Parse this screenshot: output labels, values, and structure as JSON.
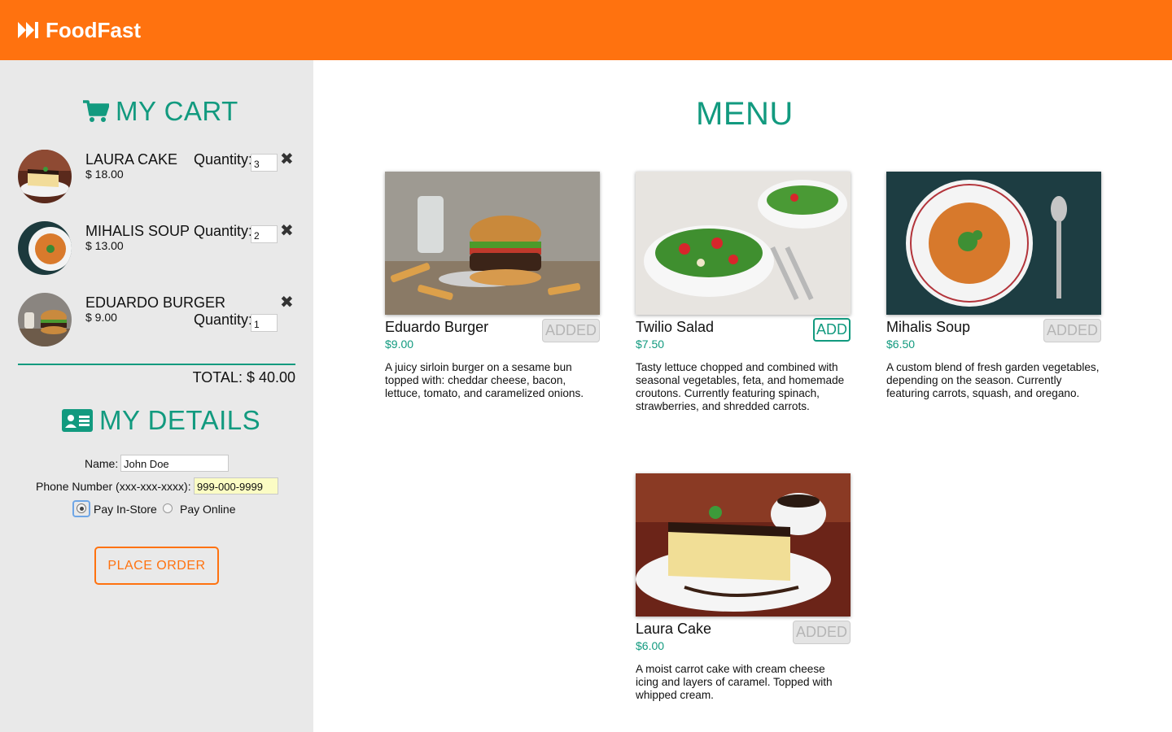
{
  "app": {
    "name": "FoodFast"
  },
  "colors": {
    "brand": "#ff720f",
    "accent": "#129a7f",
    "sidebar_bg": "#e9e9e9"
  },
  "cart": {
    "title": "MY CART",
    "quantity_label": "Quantity:",
    "items": [
      {
        "name": "LAURA CAKE",
        "price": "$ 18.00",
        "quantity": "3"
      },
      {
        "name": "MIHALIS SOUP",
        "price": "$ 13.00",
        "quantity": "2"
      },
      {
        "name": "EDUARDO BURGER",
        "price": "$ 9.00",
        "quantity": "1"
      }
    ],
    "total": "TOTAL: $ 40.00"
  },
  "details": {
    "title": "MY DETAILS",
    "name_label": "Name:",
    "name_value": "John Doe",
    "phone_label": "Phone Number (xxx-xxx-xxxx):",
    "phone_value": "999-000-9999",
    "pay_instore_label": "Pay In-Store",
    "pay_online_label": "Pay Online",
    "selected_payment": "Pay In-Store",
    "place_order_label": "PLACE ORDER"
  },
  "menu": {
    "title": "MENU",
    "items": [
      {
        "name": "Eduardo Burger",
        "price": "$9.00",
        "button": "ADDED",
        "description": "A juicy sirloin burger on a sesame bun topped with: cheddar cheese, bacon, lettuce, tomato, and caramelized onions."
      },
      {
        "name": "Twilio Salad",
        "price": "$7.50",
        "button": "ADD",
        "description": "Tasty lettuce chopped and combined with seasonal vegetables, feta, and homemade croutons. Currently featuring spinach, strawberries, and shredded carrots."
      },
      {
        "name": "Mihalis Soup",
        "price": "$6.50",
        "button": "ADDED",
        "description": "A custom blend of fresh garden vegetables, depending on the season. Currently featuring carrots, squash, and oregano."
      },
      {
        "name": "Laura Cake",
        "price": "$6.00",
        "button": "ADDED",
        "description": "A moist carrot cake with cream cheese icing and layers of caramel. Topped with whipped cream."
      }
    ]
  },
  "icons": [
    "fast-forward-icon",
    "shopping-cart-icon",
    "id-card-icon",
    "close-icon"
  ]
}
